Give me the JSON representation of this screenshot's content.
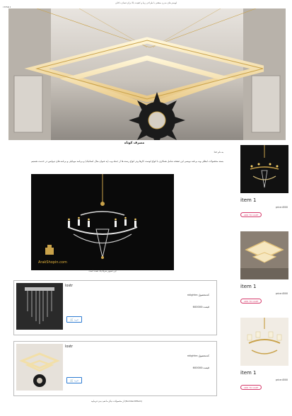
{
  "page": {
    "top_note": "لوستر های مدرن سقفی با طراحی زیبا و کیفیت بالا برای فضای داخلی",
    "top_tag": "۱۹۳۳۸۱۶"
  },
  "article": {
    "title": "مصرف کوتاه",
    "intro": "به نام خدا",
    "paragraph": "بسته محصولات ابطلی وبه برنامه نویسی این صفحه شامل همکاری با انواع لوست کارها ودر انواع رسته ها از جمله وب (به عنوان مثال استاتیک) و برنامه موبایلی و برنامه های دیوایس در خدمت هستیم",
    "image_caption": "این تصویر صرفا یک تست است",
    "image_watermark": "ArakShopin.com"
  },
  "products": [
    {
      "title": "lostr",
      "code_label": "کدمحصول:",
      "code": "nklghhn",
      "price_label": "قیمت:",
      "price": "600000",
      "buy_label": "خرید",
      "buy_icon": "cart-icon"
    },
    {
      "title": "lostr",
      "code_label": "کدمحصول:",
      "code": "nklghhn",
      "price_label": "قیمت:",
      "price": "600000",
      "buy_label": "خرید",
      "buy_icon": "cart-icon"
    }
  ],
  "footer_note": "از محصولات دیگر ما هم دیدن فرمایید (NumberOfItem)",
  "sidebar": {
    "items": [
      {
        "name": "item 1",
        "price": "price:4500",
        "button": "ADD TO CART"
      },
      {
        "name": "item 1",
        "price": "price:4500",
        "button": "ADD TO CART"
      },
      {
        "name": "item 1",
        "price": "price:4500",
        "button": "ADD TO CART"
      }
    ]
  },
  "colors": {
    "add_to_cart_border": "#d63a6b",
    "buy_button_border": "#2d7bd1",
    "hero_gold": "#c9a24a",
    "main_image_bg": "#0a0a0a"
  }
}
